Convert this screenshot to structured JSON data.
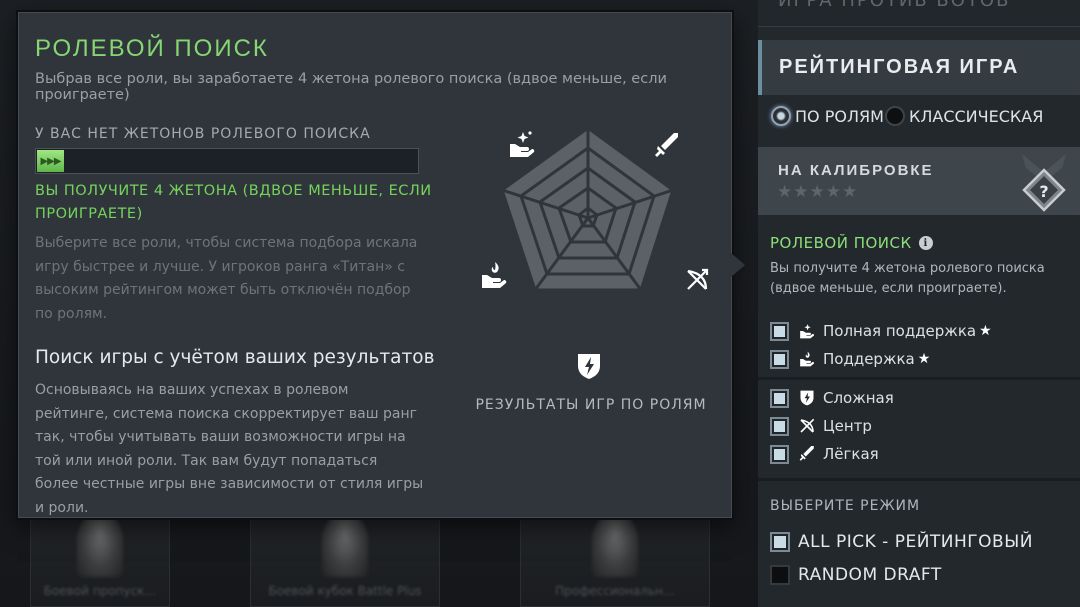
{
  "background": {
    "top_text": "ИГРА ПРОТИВ БОТОВ",
    "cards": [
      "Боевой пропуск…",
      "Боевой кубок Battle Plus",
      "Профессиональн…"
    ]
  },
  "tooltip": {
    "title": "РОЛЕВОЙ ПОИСК",
    "subtitle": "Выбрав все роли, вы заработаете 4 жетона ролевого поиска (вдвое меньше, если проиграете)",
    "tokens_label": "У ВАС НЕТ ЖЕТОНОВ РОЛЕВОГО ПОИСКА",
    "token_bar_fill": 0.07,
    "earn_text": "ВЫ ПОЛУЧИТЕ 4 ЖЕТОНА (ВДВОЕ МЕНЬШЕ, ЕСЛИ ПРОИГРАЕТЕ)",
    "description": "Выберите все роли, чтобы система подбора искала игру быстрее и лучше. У игроков ранга «Титан» с высоким рейтингом может быть отключён подбор по ролям.",
    "section_title": "Поиск игры с учётом ваших результатов",
    "section_text": "Основываясь на ваших успехах в ролевом рейтинге, система поиска скорректирует ваш ранг так, чтобы учитывать ваши возможности игры на той или иной роли. Так вам будут попадаться более честные игры вне зависимости от стиля игры и роли.",
    "radar_caption": "РЕЗУЛЬТАТЫ ИГР ПО РОЛЯМ",
    "radar_icons": [
      "support-sparkle-icon",
      "sword-icon",
      "bow-icon",
      "shield-bolt-icon",
      "hand-flame-icon"
    ]
  },
  "sidebar": {
    "header": "РЕЙТИНГОВАЯ ИГРА",
    "mode_options": [
      {
        "label": "ПО РОЛЯМ",
        "selected": true
      },
      {
        "label": "КЛАССИЧЕСКАЯ",
        "selected": false
      }
    ],
    "calibration_label": "НА КАЛИБРОВКЕ",
    "calibration_stars": "★★★★★",
    "role_search_title": "РОЛЕВОЙ ПОИСК",
    "role_search_desc": "Вы получите 4 жетона ролевого поиска (вдвое меньше, если проиграете).",
    "roles": [
      {
        "label": "Полная поддержка",
        "star": "★",
        "icon": "hand-sparkle-icon",
        "checked": true
      },
      {
        "label": "Поддержка",
        "star": "★",
        "icon": "hand-flame-icon",
        "checked": true
      },
      {
        "label": "Сложная",
        "star": "",
        "icon": "shield-bolt-icon",
        "checked": true
      },
      {
        "label": "Центр",
        "star": "",
        "icon": "bow-icon",
        "checked": true
      },
      {
        "label": "Лёгкая",
        "star": "",
        "icon": "sword-icon",
        "checked": true
      }
    ],
    "select_mode_title": "ВЫБЕРИТЕ РЕЖИМ",
    "game_modes": [
      {
        "label": "ALL PICK - РЕЙТИНГОВЫЙ",
        "checked": true
      },
      {
        "label": "RANDOM DRAFT",
        "checked": false
      }
    ]
  }
}
